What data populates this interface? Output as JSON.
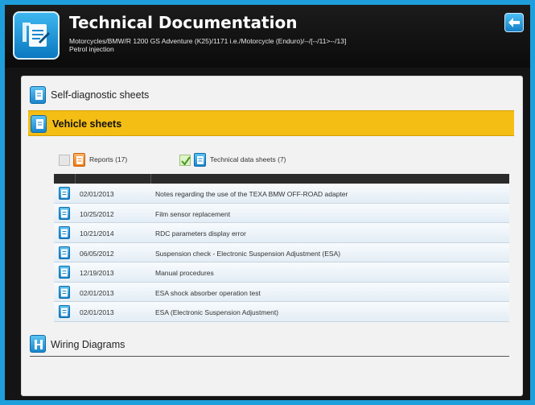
{
  "header": {
    "title": "Technical Documentation",
    "subtitle_line1": "Motorcycles/BMW/R 1200 GS Adventure (K25)/1171 i.e./Motorcycle (Enduro)/--/[--/11>--/13]",
    "subtitle_line2": "Petrol injection",
    "app_icon": "document-wrench-icon",
    "back_icon": "back-arrow-icon"
  },
  "sections": {
    "self_diagnostic": "Self-diagnostic sheets",
    "vehicle": "Vehicle sheets",
    "wiring": "Wiring Diagrams"
  },
  "filters": {
    "reports": {
      "label": "Reports (17)",
      "checked": false
    },
    "technical": {
      "label": "Technical data sheets (7)",
      "checked": true
    }
  },
  "table": {
    "rows": [
      {
        "date": "02/01/2013",
        "desc": "Notes regarding the use of the TEXA BMW OFF-ROAD adapter"
      },
      {
        "date": "10/25/2012",
        "desc": "Film sensor replacement"
      },
      {
        "date": "10/21/2014",
        "desc": "RDC parameters display error"
      },
      {
        "date": "06/05/2012",
        "desc": "Suspension check - Electronic Suspension Adjustment (ESA)"
      },
      {
        "date": "12/19/2013",
        "desc": "Manual procedures"
      },
      {
        "date": "02/01/2013",
        "desc": "ESA shock absorber operation test"
      },
      {
        "date": "02/01/2013",
        "desc": "ESA (Electronic Suspension Adjustment)"
      }
    ]
  },
  "colors": {
    "frame_blue": "#1e9fdc",
    "header_black": "#111111",
    "vehicle_yellow": "#f5be14",
    "icon_blue": "#1b86cc",
    "report_orange": "#f07b12"
  }
}
